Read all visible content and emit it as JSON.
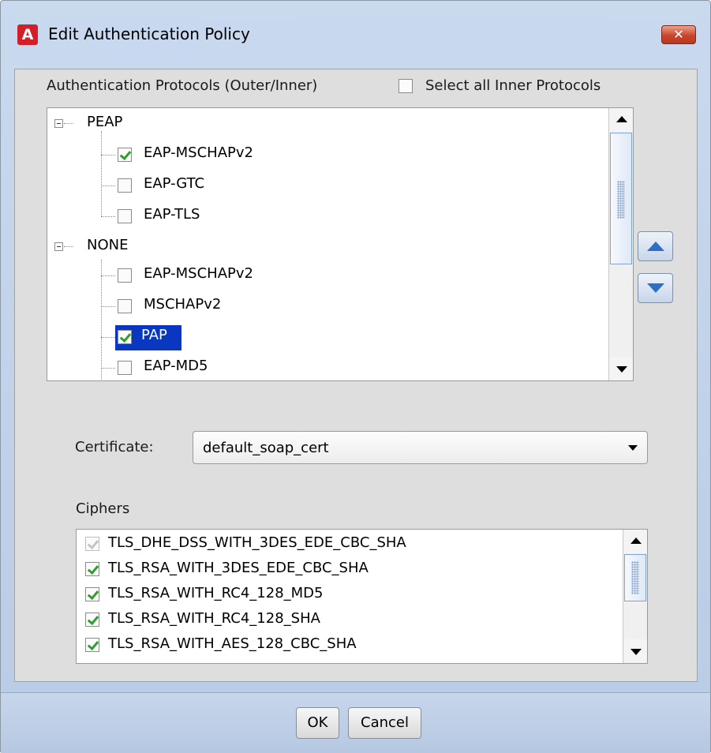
{
  "window": {
    "title": "Edit Authentication Policy",
    "app_icon_letter": "A",
    "close_symbol": "✕",
    "accent_color": "#d0202a"
  },
  "protocols": {
    "section_label": "Authentication Protocols (Outer/Inner)",
    "select_all_label": "Select all Inner Protocols",
    "select_all_checked": false,
    "groups": [
      {
        "label": "PEAP",
        "children": [
          {
            "label": "EAP-MSCHAPv2",
            "checked": true
          },
          {
            "label": "EAP-GTC",
            "checked": false
          },
          {
            "label": "EAP-TLS",
            "checked": false
          }
        ]
      },
      {
        "label": "NONE",
        "children": [
          {
            "label": "EAP-MSCHAPv2",
            "checked": false
          },
          {
            "label": "MSCHAPv2",
            "checked": false
          },
          {
            "label": "PAP",
            "checked": true,
            "selected": true
          },
          {
            "label": "EAP-MD5",
            "checked": false
          }
        ]
      }
    ]
  },
  "certificate": {
    "label": "Certificate:",
    "value": "default_soap_cert"
  },
  "ciphers": {
    "label": "Ciphers",
    "items": [
      {
        "label": "TLS_DHE_DSS_WITH_3DES_EDE_CBC_SHA",
        "checked": true,
        "disabled": true
      },
      {
        "label": "TLS_RSA_WITH_3DES_EDE_CBC_SHA",
        "checked": true
      },
      {
        "label": "TLS_RSA_WITH_RC4_128_MD5",
        "checked": true
      },
      {
        "label": "TLS_RSA_WITH_RC4_128_SHA",
        "checked": true
      },
      {
        "label": "TLS_RSA_WITH_AES_128_CBC_SHA",
        "checked": true
      }
    ]
  },
  "buttons": {
    "ok": "OK",
    "cancel": "Cancel"
  }
}
